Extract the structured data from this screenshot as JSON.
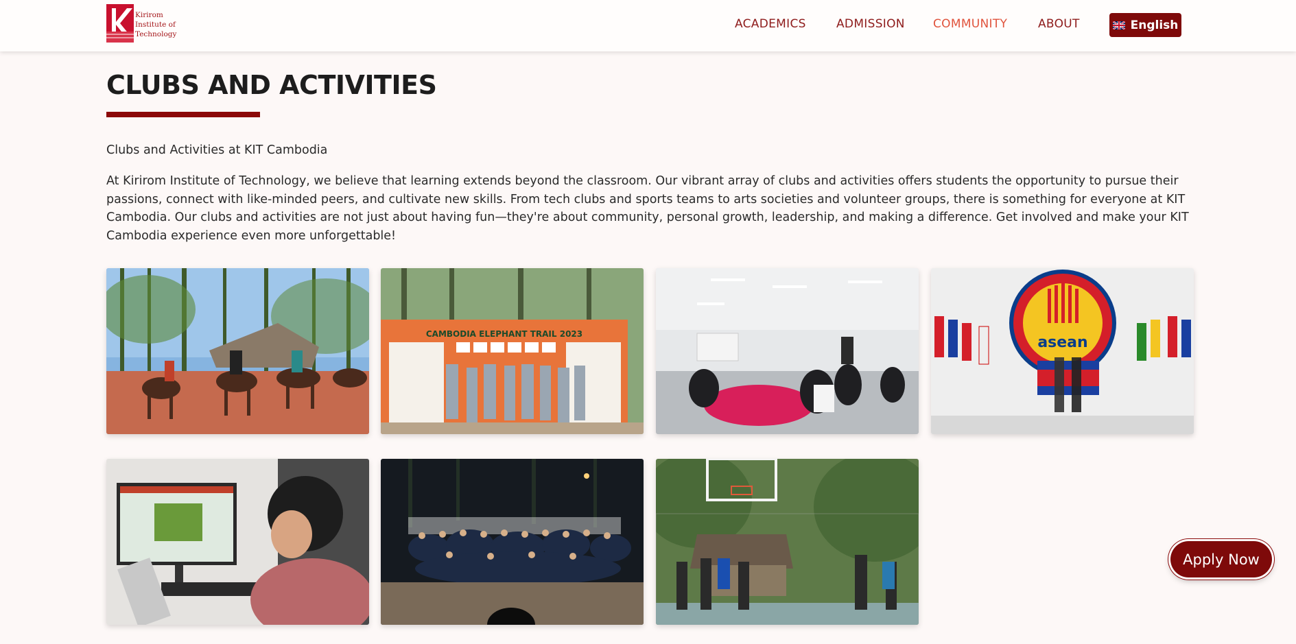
{
  "header": {
    "logo_lines": [
      "Kirirom",
      "Institute of",
      "Technology"
    ],
    "nav": [
      {
        "label": "ACADEMICS",
        "active": false
      },
      {
        "label": "ADMISSION",
        "active": false
      },
      {
        "label": "COMMUNITY",
        "active": true
      },
      {
        "label": "ABOUT",
        "active": false
      }
    ],
    "language_label": "English",
    "language_icon": "uk-flag-icon"
  },
  "main": {
    "title": "CLUBS AND ACTIVITIES",
    "subtitle": "Clubs and Activities at KIT Cambodia",
    "description": "At Kirirom Institute of Technology, we believe that learning extends beyond the classroom. Our vibrant array of clubs and activities offers students the opportunity to pursue their passions, connect with like-minded peers, and cultivate new skills. From tech clubs and sports teams to arts societies and volunteer groups, there is something for everyone at KIT Cambodia. Our clubs and activities are not just about having fun—they're about community, personal growth, leadership, and making a difference. Get involved and make your KIT Cambodia experience even more unforgettable!",
    "gallery": [
      {
        "photo": "horse-riding-photo"
      },
      {
        "photo": "elephant-trail-photo",
        "sign_text": "CAMBODIA ELEPHANT TRAIL 2023"
      },
      {
        "photo": "workshop-photo"
      },
      {
        "photo": "asean-flags-photo",
        "sign_text": "asean"
      },
      {
        "photo": "gaming-photo"
      },
      {
        "photo": "night-group-photo"
      },
      {
        "photo": "basketball-photo"
      }
    ]
  },
  "cta": {
    "apply_label": "Apply Now"
  },
  "colors": {
    "brand": "#7e0a0a",
    "nav_text": "#8e1b1b",
    "nav_active": "#e0533c",
    "background": "#fdf8f7"
  }
}
